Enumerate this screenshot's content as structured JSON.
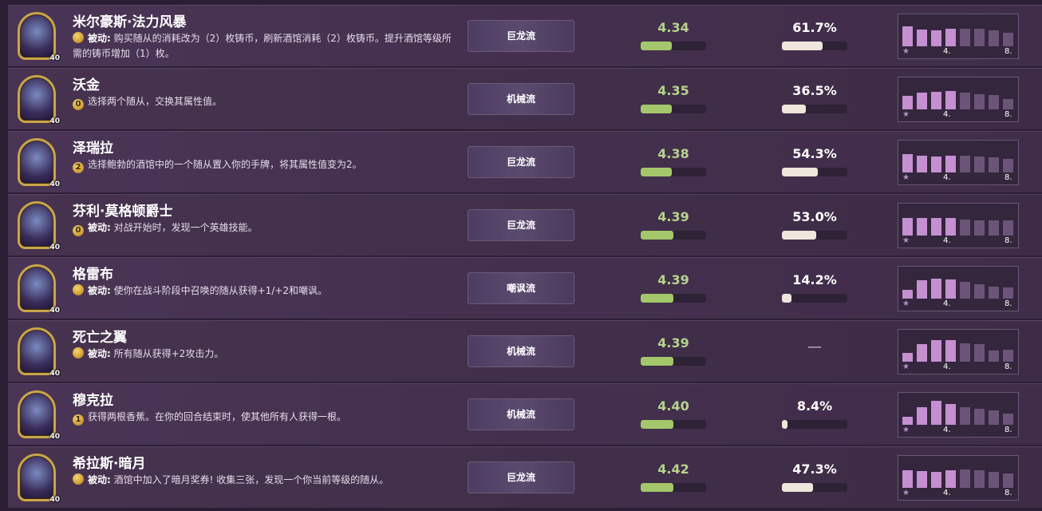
{
  "heroes": [
    {
      "name": "米尔豪斯·法力风暴",
      "coin": "",
      "passive": "被动:",
      "desc": " 购买随从的消耗改为（2）枚铸币，刷新酒馆消耗（2）枚铸币。提升酒馆等级所需的铸币增加（1）枚。",
      "level": "40",
      "tag": "巨龙流",
      "score": "4.34",
      "score_fill": 0.48,
      "pct": "61.7%",
      "pct_fill": 0.617,
      "dist": [
        0.62,
        0.52,
        0.5,
        0.56,
        0.55,
        0.56,
        0.5,
        0.42
      ],
      "dist_bright": 4
    },
    {
      "name": "沃金",
      "coin": "0",
      "passive": "",
      "desc": "选择两个随从，交换其属性值。",
      "level": "40",
      "tag": "机械流",
      "score": "4.35",
      "score_fill": 0.48,
      "pct": "36.5%",
      "pct_fill": 0.365,
      "dist": [
        0.42,
        0.52,
        0.55,
        0.58,
        0.52,
        0.48,
        0.45,
        0.33
      ],
      "dist_bright": 4
    },
    {
      "name": "泽瑞拉",
      "coin": "2",
      "passive": "",
      "desc": "选择鲍勃的酒馆中的一个随从置入你的手牌，将其属性值变为2。",
      "level": "40",
      "tag": "巨龙流",
      "score": "4.38",
      "score_fill": 0.48,
      "pct": "54.3%",
      "pct_fill": 0.543,
      "dist": [
        0.57,
        0.52,
        0.5,
        0.52,
        0.52,
        0.5,
        0.48,
        0.42
      ],
      "dist_bright": 4
    },
    {
      "name": "芬利·莫格顿爵士",
      "coin": "0",
      "passive": "被动:",
      "desc": " 对战开始时，发现一个英雄技能。",
      "level": "40",
      "tag": "巨龙流",
      "score": "4.39",
      "score_fill": 0.5,
      "pct": "53.0%",
      "pct_fill": 0.53,
      "dist": [
        0.55,
        0.55,
        0.55,
        0.55,
        0.5,
        0.48,
        0.48,
        0.47
      ],
      "dist_bright": 4
    },
    {
      "name": "格雷布",
      "coin": "",
      "passive": "被动:",
      "desc": " 使你在战斗阶段中召唤的随从获得+1/+2和嘲讽。",
      "level": "40",
      "tag": "嘲讽流",
      "score": "4.39",
      "score_fill": 0.5,
      "pct": "14.2%",
      "pct_fill": 0.142,
      "dist": [
        0.28,
        0.58,
        0.62,
        0.6,
        0.52,
        0.45,
        0.38,
        0.35
      ],
      "dist_bright": 4
    },
    {
      "name": "死亡之翼",
      "coin": "",
      "passive": "被动:",
      "desc": " 所有随从获得+2攻击力。",
      "level": "40",
      "tag": "机械流",
      "score": "4.39",
      "score_fill": 0.5,
      "pct": "",
      "pct_fill": 0,
      "dash": "—",
      "dist": [
        0.28,
        0.55,
        0.68,
        0.68,
        0.58,
        0.55,
        0.35,
        0.38
      ],
      "dist_bright": 4
    },
    {
      "name": "穆克拉",
      "coin": "1",
      "passive": "",
      "desc": "获得两根香蕉。在你的回合结束时，使其他所有人获得一根。",
      "level": "40",
      "tag": "机械流",
      "score": "4.40",
      "score_fill": 0.5,
      "pct": "8.4%",
      "pct_fill": 0.084,
      "dist": [
        0.25,
        0.55,
        0.75,
        0.65,
        0.55,
        0.5,
        0.45,
        0.35
      ],
      "dist_bright": 4
    },
    {
      "name": "希拉斯·暗月",
      "coin": "",
      "passive": "被动:",
      "desc": " 酒馆中加入了暗月奖券! 收集三张，发现一个你当前等级的随从。",
      "level": "40",
      "tag": "巨龙流",
      "score": "4.42",
      "score_fill": 0.5,
      "pct": "47.3%",
      "pct_fill": 0.473,
      "dist": [
        0.55,
        0.53,
        0.5,
        0.55,
        0.58,
        0.55,
        0.5,
        0.45
      ],
      "dist_bright": 4
    }
  ],
  "axis": {
    "star": "★",
    "tick4": "4.",
    "tick8": "8."
  },
  "colors": {
    "score": "#a3c76a",
    "pct": "#efe6dc",
    "dist_bar": "#c58fd2"
  }
}
